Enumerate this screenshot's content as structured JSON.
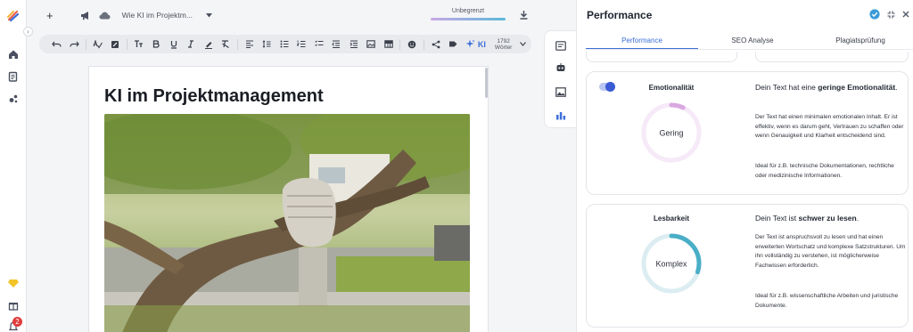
{
  "topbar": {
    "add_label": "+",
    "doc_name": "Wie KI im Projektm...",
    "usage_label": "Unbegrenzt"
  },
  "toolbar": {
    "ki_label": "KI",
    "word_count": "1792",
    "word_unit": "Wörter"
  },
  "rail": {
    "notification_count": "2"
  },
  "document": {
    "title": "KI im Projektmanagement"
  },
  "panel": {
    "title": "Performance",
    "tabs": [
      {
        "label": "Performance",
        "active": true
      },
      {
        "label": "SEO Analyse",
        "active": false
      },
      {
        "label": "Plagiatsprüfung",
        "active": false
      }
    ],
    "emotion": {
      "title": "Emotionalität",
      "ring_label": "Gering",
      "ring_level": 0.07,
      "head_prefix": "Dein Text hat eine ",
      "head_bold": "geringe Emotionalität",
      "head_suffix": ".",
      "para1": "Der Text hat einen minimalen emotionalen Inhalt. Er ist effektiv, wenn es darum geht, Vertrauen zu schaffen oder wenn Genauigkeit und Klarheit entscheidend sind.",
      "para2": "Ideal für z.B. technische Dokumentationen, rechtliche oder medizinische Informationen."
    },
    "readability": {
      "title": "Lesbarkeit",
      "ring_label": "Komplex",
      "ring_level": 0.3,
      "head_prefix": "Dein Text ist ",
      "head_bold": "schwer zu lesen",
      "head_suffix": ".",
      "para1": "Der Text ist anspruchsvoll zu lesen und hat einen erweiterten Wortschatz und komplexe Satzstrukturen. Um ihn vollständig zu verstehen, ist möglicherweise Fachwissen erforderlich.",
      "para2": "Ideal für z.B. wissenschaftliche Arbeiten und juristische Dokumente."
    }
  },
  "colors": {
    "accent": "#3d6fd8",
    "emotion_ring": "#d9a8e0",
    "emotion_track": "#f6e9f8",
    "readability_ring": "#4aaec6",
    "readability_track": "#dcedf2",
    "badge": "#e03c3c"
  }
}
